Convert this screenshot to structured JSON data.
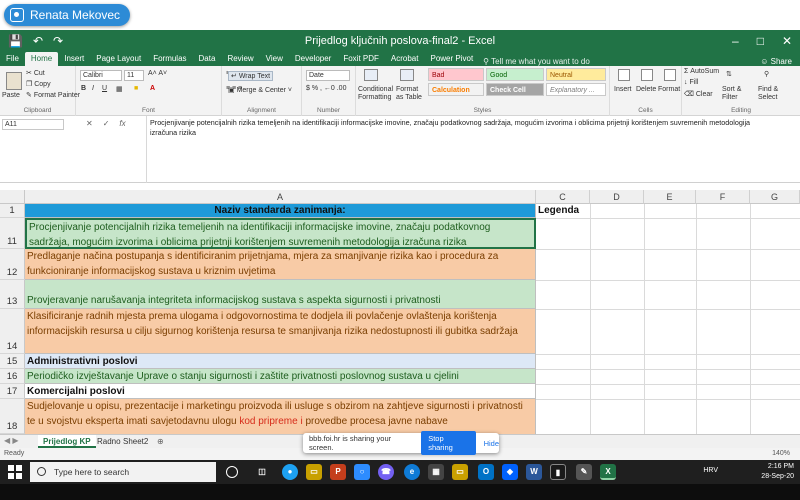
{
  "presenter": {
    "name": "Renata Mekovec"
  },
  "window": {
    "title": "Prijedlog ključnih poslova-final2 - Excel",
    "share_label": "Share"
  },
  "ribbon_tabs": [
    "File",
    "Home",
    "Insert",
    "Page Layout",
    "Formulas",
    "Data",
    "Review",
    "View",
    "Developer",
    "Foxit PDF",
    "Acrobat",
    "Power Pivot"
  ],
  "active_tab": "Home",
  "tell_me": "Tell me what you want to do",
  "ribbon": {
    "clipboard": {
      "paste": "Paste",
      "cut": "Cut",
      "copy": "Copy",
      "format_painter": "Format Painter",
      "label": "Clipboard"
    },
    "font": {
      "name": "Calibri",
      "size": "11",
      "label": "Font"
    },
    "alignment": {
      "wrap_text": "Wrap Text",
      "merge": "Merge & Center",
      "label": "Alignment"
    },
    "number": {
      "format": "Date",
      "label": "Number"
    },
    "styles": {
      "conditional": "Conditional Formatting",
      "format_as_table": "Format as Table",
      "bad": "Bad",
      "good": "Good",
      "neutral": "Neutral",
      "calculation": "Calculation",
      "check_cell": "Check Cell",
      "explanatory": "Explanatory ...",
      "label": "Styles"
    },
    "cells": {
      "insert": "Insert",
      "delete": "Delete",
      "format": "Format",
      "label": "Cells"
    },
    "editing": {
      "autosum": "AutoSum",
      "fill": "Fill",
      "clear": "Clear",
      "sort": "Sort & Filter",
      "find": "Find & Select",
      "label": "Editing"
    }
  },
  "formula_bar": {
    "name_box": "A11",
    "content": "Procjenjivanje potencijalnih rizika temeljenih na identifikaciji informacijske imovine, značaju podatkovnog sadržaja, mogućim izvorima i oblicima prijetnji korištenjem suvremenih metodologija izračuna rizika"
  },
  "columns": [
    "A",
    "C",
    "D",
    "E",
    "F",
    "G"
  ],
  "legend_header": "Legenda",
  "rows": [
    {
      "num": "1",
      "text": "Naziv standarda zanimanja:"
    },
    {
      "num": "11",
      "text": "Procjenjivanje potencijalnih rizika temeljenih na identifikaciji informacijske imovine, značaju podatkovnog sadržaja, mogućim izvorima i oblicima prijetnji korištenjem suvremenih metodologija izračuna rizika"
    },
    {
      "num": "12",
      "text": "Predlaganje načina postupanja s identificiranim prijetnjama, mjera za smanjivanje rizika kao i procedura za funkcioniranje informacijskog sustava u kriznim uvjetima"
    },
    {
      "num": "13",
      "text": "Provjeravanje narušavanja integriteta informacijskog sustava s aspekta sigurnosti i privatnosti"
    },
    {
      "num": "14",
      "text": "Klasificiranje radnih mjesta prema ulogama i odgovornostima te dodjela ili povlačenje ovlaštenja korištenja informacijskih resursa  u cilju sigurnog korištenja resursa te smanjivanja rizika nedostupnosti ili gubitka sadržaja"
    },
    {
      "num": "15",
      "text": "Administrativni poslovi"
    },
    {
      "num": "16",
      "text": "Periodičko izvještavanje Uprave o stanju sigurnosti i zaštite privatnosti poslovnog sustava u cjelini"
    },
    {
      "num": "17",
      "text": "Komercijalni poslovi"
    },
    {
      "num": "18",
      "text_before": "Sudjelovanje u opisu, prezentacije i marketingu proizvoda ili usluge s obzirom na zahtjeve sigurnosti i privatnosti te u svojstvu eksperta imati savjetodavnu ulogu ",
      "text_red": "kod pripreme i",
      "text_after": " provedbe procesa javne nabave"
    }
  ],
  "sheet_tabs": [
    "Prijedlog KP",
    "Radno",
    "Sheet2"
  ],
  "status": {
    "ready": "Ready",
    "zoom": "140%"
  },
  "share_popup": {
    "message": "bbb.foi.hr is sharing your screen.",
    "stop": "Stop sharing",
    "hide": "Hide"
  },
  "taskbar": {
    "search_placeholder": "Type here to search",
    "time": "2:16 PM",
    "date": "28-Sep-20",
    "language": "HRV"
  }
}
